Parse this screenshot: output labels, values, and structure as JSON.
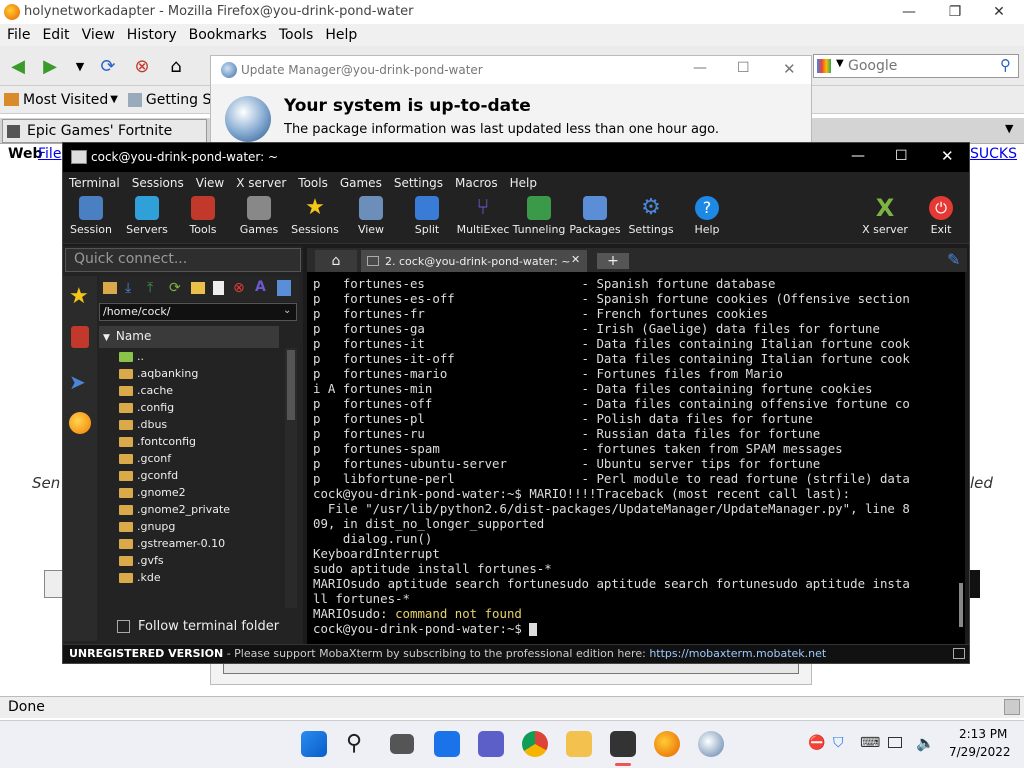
{
  "firefox": {
    "title": "holynetworkadapter - Mozilla Firefox@you-drink-pond-water",
    "menu": [
      "File",
      "Edit",
      "View",
      "History",
      "Bookmarks",
      "Tools",
      "Help"
    ],
    "search_placeholder": "Google",
    "bookmarks": [
      "Most Visited",
      "Getting St"
    ],
    "tab_title": "Epic Games' Fortnite",
    "content_left_web": "Web",
    "content_left_link": "File",
    "content_right_link": "SUCKS",
    "content_left_partial": "Sen",
    "content_right_partial": "led",
    "status": "Done"
  },
  "update_manager": {
    "title": "Update Manager@you-drink-pond-water",
    "heading": "Your system is up-to-date",
    "subtext": "The package information was last updated less than one hour ago."
  },
  "mobaxterm": {
    "title": "cock@you-drink-pond-water: ~",
    "menu": [
      "Terminal",
      "Sessions",
      "View",
      "X server",
      "Tools",
      "Games",
      "Settings",
      "Macros",
      "Help"
    ],
    "tools": [
      "Session",
      "Servers",
      "Tools",
      "Games",
      "Sessions",
      "View",
      "Split",
      "MultiExec",
      "Tunneling",
      "Packages",
      "Settings",
      "Help"
    ],
    "tools_right": [
      "X server",
      "Exit"
    ],
    "quick_connect": "Quick connect...",
    "path": "/home/cock/",
    "name_header": "Name",
    "files": [
      "..",
      ".aqbanking",
      ".cache",
      ".config",
      ".dbus",
      ".fontconfig",
      ".gconf",
      ".gconfd",
      ".gnome2",
      ".gnome2_private",
      ".gnupg",
      ".gstreamer-0.10",
      ".gvfs",
      ".kde"
    ],
    "follow_label": "Follow terminal folder",
    "tab_label": "2. cock@you-drink-pond-water: ~",
    "terminal_lines": [
      "p   fortunes-es                     - Spanish fortune database",
      "p   fortunes-es-off                 - Spanish fortune cookies (Offensive section",
      "p   fortunes-fr                     - French fortunes cookies",
      "p   fortunes-ga                     - Irish (Gaelige) data files for fortune",
      "p   fortunes-it                     - Data files containing Italian fortune cook",
      "p   fortunes-it-off                 - Data files containing Italian fortune cook",
      "p   fortunes-mario                  - Fortunes files from Mario",
      "i A fortunes-min                    - Data files containing fortune cookies",
      "p   fortunes-off                    - Data files containing offensive fortune co",
      "p   fortunes-pl                     - Polish data files for fortune",
      "p   fortunes-ru                     - Russian data files for fortune",
      "p   fortunes-spam                   - fortunes taken from SPAM messages",
      "p   fortunes-ubuntu-server          - Ubuntu server tips for fortune",
      "p   libfortune-perl                 - Perl module to read fortune (strfile) data",
      "cock@you-drink-pond-water:~$ MARIO!!!!Traceback (most recent call last):",
      "  File \"/usr/lib/python2.6/dist-packages/UpdateManager/UpdateManager.py\", line 8",
      "09, in dist_no_longer_supported",
      "    dialog.run()",
      "KeyboardInterrupt",
      "sudo aptitude install fortunes-*",
      "MARIOsudo aptitude search fortunesudo aptitude search fortunesudo aptitude insta",
      "ll fortunes-*"
    ],
    "not_found_prefix": "MARIOsudo: ",
    "not_found_msg": "command not found",
    "prompt": "cock@you-drink-pond-water:~$ ",
    "status_bold": "UNREGISTERED VERSION",
    "status_text": "  -  Please support MobaXterm by subscribing to the professional edition here: ",
    "status_link": "https://mobaxterm.mobatek.net"
  },
  "taskbar": {
    "time": "2:13 PM",
    "date": "7/29/2022"
  },
  "colors": {
    "terminal_bg": "#000000",
    "terminal_warn": "#e5d26b",
    "link_blue": "#0000ee",
    "taskbar_bg": "#eef0f5"
  }
}
